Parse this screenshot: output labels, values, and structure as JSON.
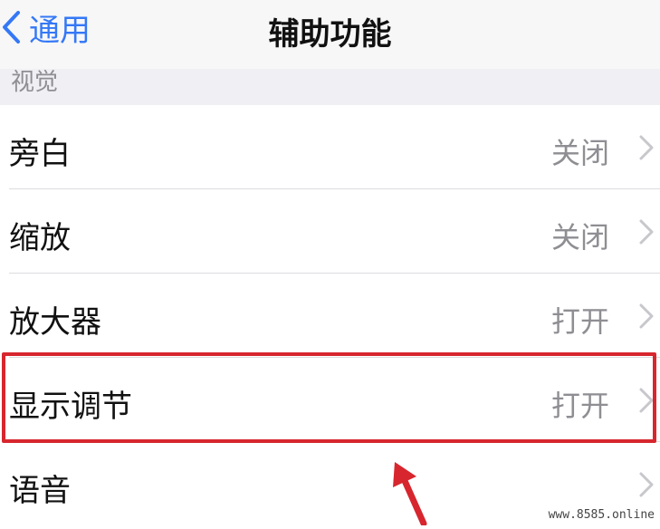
{
  "nav": {
    "back_label": "通用",
    "title": "辅助功能"
  },
  "section": {
    "header": "视觉"
  },
  "rows": [
    {
      "label": "旁白",
      "value": "关闭"
    },
    {
      "label": "缩放",
      "value": "关闭"
    },
    {
      "label": "放大器",
      "value": "打开"
    },
    {
      "label": "显示调节",
      "value": "打开"
    },
    {
      "label": "语音",
      "value": ""
    }
  ],
  "annotation": {
    "highlight_color": "#d7262e",
    "highlighted_row": "显示调节"
  },
  "watermark": "www.8585.online",
  "colors": {
    "accent": "#3478f6",
    "secondary_text": "#8e8e93",
    "chevron": "#c7c7cc"
  }
}
